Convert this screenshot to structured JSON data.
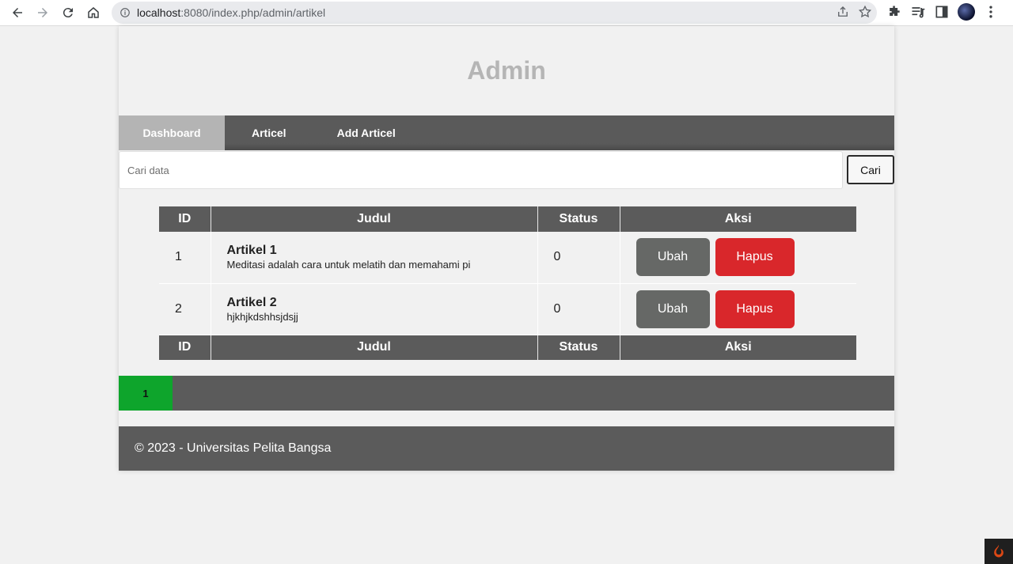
{
  "browser": {
    "url_host": "localhost",
    "url_rest": ":8080/index.php/admin/artikel"
  },
  "header": {
    "title": "Admin"
  },
  "nav": {
    "items": [
      "Dashboard",
      "Articel",
      "Add Articel"
    ]
  },
  "search": {
    "placeholder": "Cari data",
    "button": "Cari"
  },
  "table": {
    "headers": [
      "ID",
      "Judul",
      "Status",
      "Aksi"
    ],
    "rows": [
      {
        "id": "1",
        "title": "Artikel 1",
        "desc": "Meditasi adalah cara untuk melatih dan memahami pi",
        "status": "0",
        "edit": "Ubah",
        "delete": "Hapus"
      },
      {
        "id": "2",
        "title": "Artikel 2",
        "desc": "hjkhjkdshhsjdsjj",
        "status": "0",
        "edit": "Ubah",
        "delete": "Hapus"
      }
    ]
  },
  "pagination": {
    "current": "1"
  },
  "footer": {
    "text": "© 2023 - Universitas Pelita Bangsa"
  },
  "colors": {
    "accent_green": "#0ea52c",
    "danger": "#d9272b",
    "nav": "#5b5b5b"
  }
}
